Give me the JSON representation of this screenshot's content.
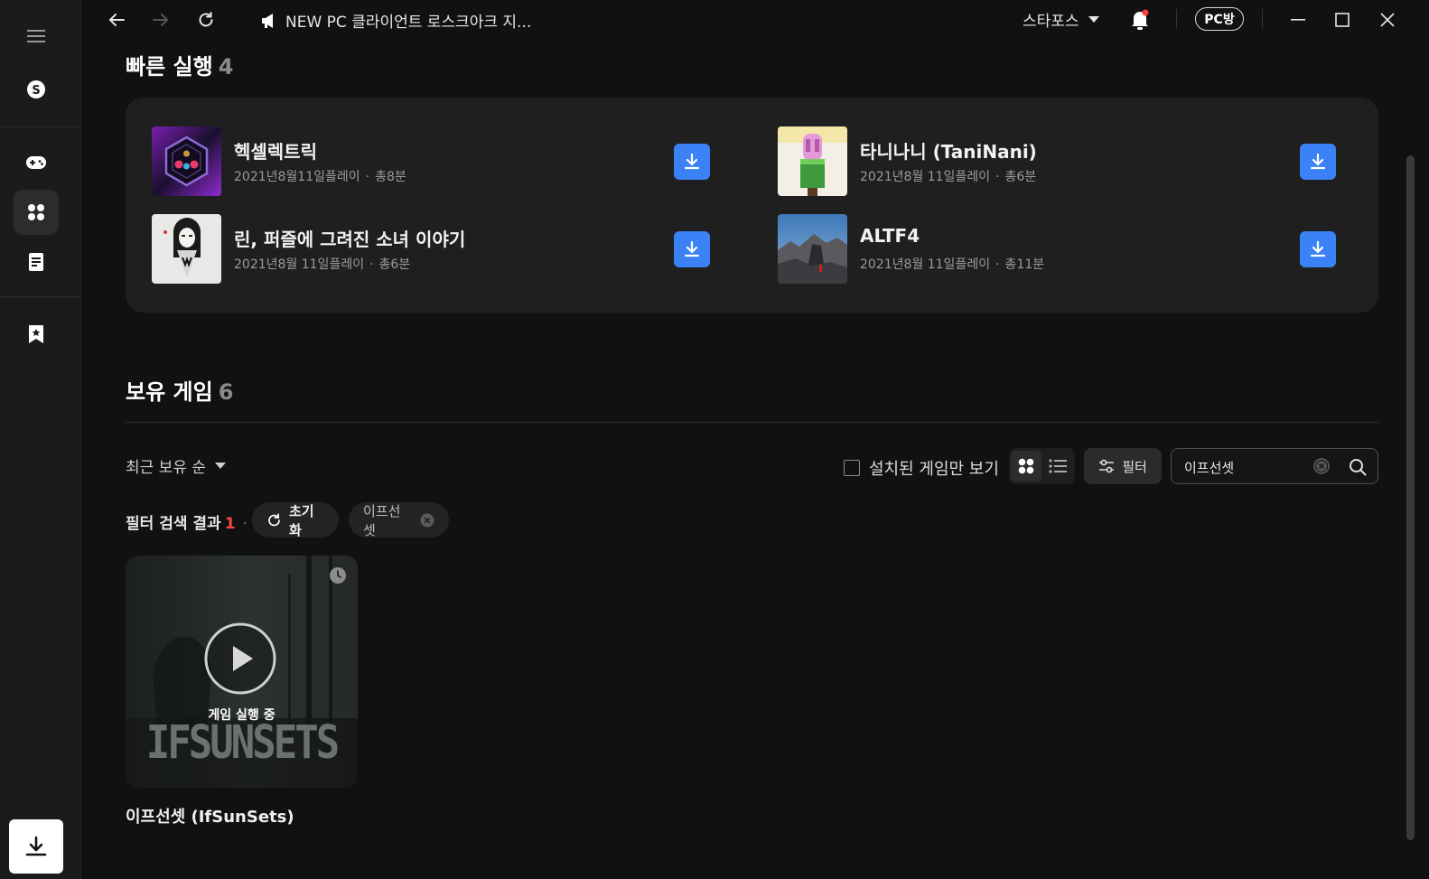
{
  "window": {
    "title": "NEW PC 클라이언트 로스크아크 지...",
    "account": "스타포스",
    "pcbang": "PC방",
    "colors": {
      "accent": "#3b82f6",
      "notify": "#ff4040"
    }
  },
  "sidebar": {
    "items": [
      {
        "icon": "menu-icon"
      },
      {
        "icon": "stove-logo-icon"
      },
      {
        "icon": "gamepad-icon"
      },
      {
        "icon": "library-icon",
        "active": true
      },
      {
        "icon": "document-icon"
      },
      {
        "icon": "bookmark-star-icon"
      },
      {
        "icon": "download-icon"
      }
    ]
  },
  "quick_launch": {
    "title": "빠른 실행",
    "count": "4",
    "games": [
      {
        "name": "헥셀렉트릭",
        "date": "2021년8월11일플레이",
        "total": "총8분"
      },
      {
        "name": "타니나니 (TaniNani)",
        "date": "2021년8월 11일플레이",
        "total": "총6분"
      },
      {
        "name": "린, 퍼즐에 그려진 소녀 이야기",
        "date": "2021년8월 11일플레이",
        "total": "총6분"
      },
      {
        "name": "ALTF4",
        "date": "2021년8월 11일플레이",
        "total": "총11분"
      }
    ]
  },
  "owned": {
    "title": "보유 게임",
    "count": "6",
    "sort_label": "최근 보유 순",
    "installed_only_label": "설치된 게임만 보기",
    "filter_label": "필터",
    "search_value": "이프선셋",
    "filter_result_label": "필터 검색 결과",
    "filter_result_count": "1",
    "filter_sep": "·",
    "reset_label": "초기화",
    "chip_label": "이프선셋",
    "games": [
      {
        "name": "이프선셋 (IfSunSets)",
        "status": "게임 실행 중",
        "logo": "IFSUNSETS"
      }
    ]
  }
}
